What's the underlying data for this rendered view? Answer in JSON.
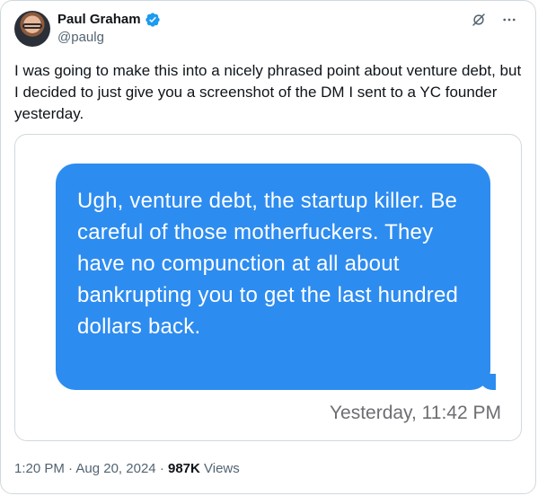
{
  "author": {
    "name": "Paul Graham",
    "handle": "@paulg",
    "verified_icon": "verified-badge-icon",
    "verified_color": "#1d9bf0"
  },
  "header_icons": [
    "grok-slash-icon",
    "more-dots-icon"
  ],
  "tweet": {
    "text": "I was going to make this into a nicely phrased point about venture debt, but I decided to just give you a screenshot of the DM I sent to a YC founder yesterday."
  },
  "screenshot": {
    "message": "Ugh, venture debt, the startup killer. Be careful of those motherfuckers. They have no compunction at all about bankrupting you to get the last hundred dollars back.",
    "timestamp": "Yesterday, 11:42 PM",
    "bubble_color": "#2d8cf0"
  },
  "meta": {
    "time": "1:20 PM",
    "date": "Aug 20, 2024",
    "views_count": "987K",
    "views_label": "Views",
    "separator": "·"
  }
}
